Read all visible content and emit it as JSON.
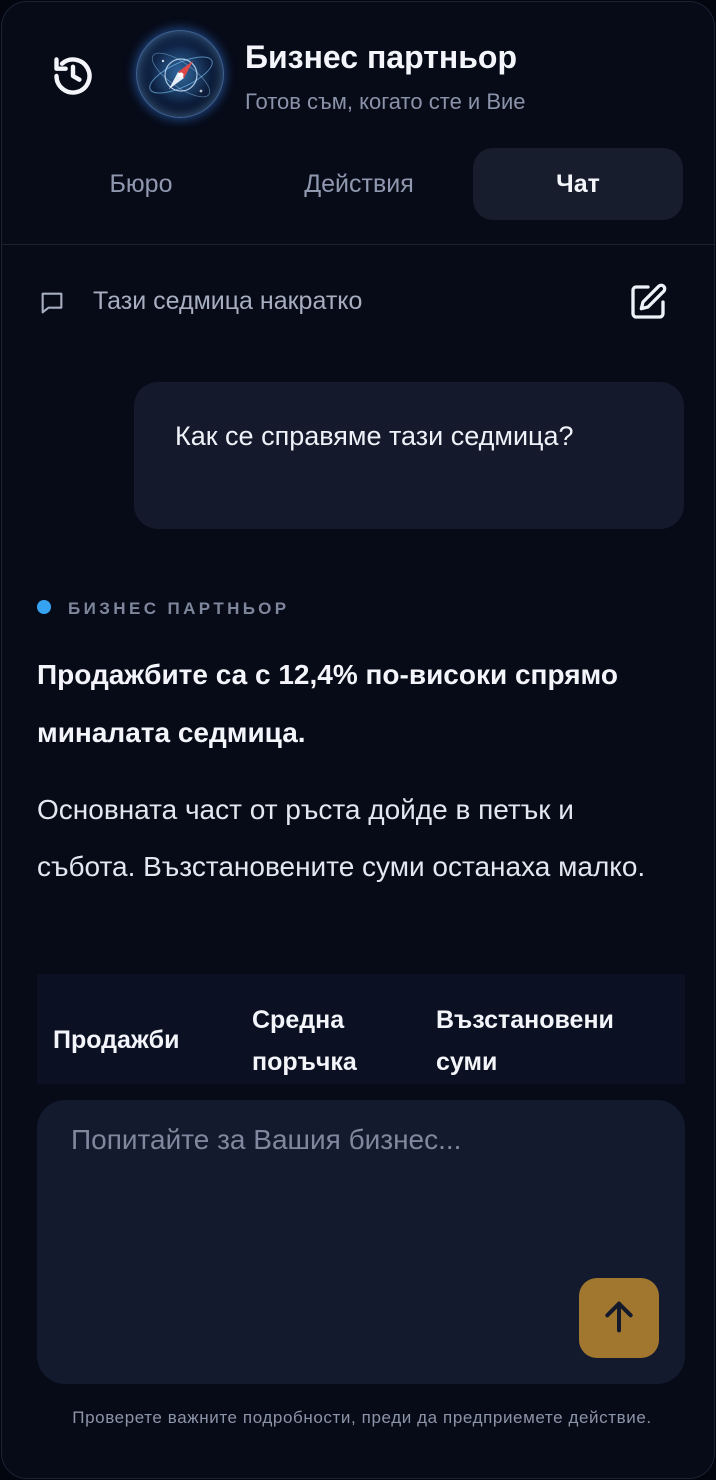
{
  "header": {
    "title": "Бизнес партньор",
    "subtitle": "Готов съм, когато сте и Вие",
    "history_icon": "history-icon",
    "avatar_icon": "compass-icon"
  },
  "tabs": [
    {
      "label": "Бюро",
      "active": false
    },
    {
      "label": "Действия",
      "active": false
    },
    {
      "label": "Чат",
      "active": true
    }
  ],
  "thread": {
    "title": "Тази седмица накратко",
    "thread_icon": "chat-bubble-icon",
    "edit_icon": "edit-icon"
  },
  "messages": {
    "user": "Как се справяме тази седмица?",
    "agent_label": "БИЗНЕС ПАРТНЬОР",
    "agent_headline": "Продажбите са с 12,4% по-високи спрямо миналата седмица.",
    "agent_body": "Основната част от ръста дойде в петък и събота. Възстановените суми останаха малко."
  },
  "table": {
    "columns": [
      "Продажби",
      "Средна поръчка",
      "Възстановени суми"
    ]
  },
  "composer": {
    "placeholder": "Попитайте за Вашия бизнес...",
    "value": "",
    "send_icon": "arrow-up-icon"
  },
  "disclaimer": "Проверете важните подробности, преди да предприемете действие.",
  "colors": {
    "background": "#070b18",
    "accent_blue": "#35a3f2",
    "send_button": "#a1772f",
    "bubble": "#141a2c"
  }
}
